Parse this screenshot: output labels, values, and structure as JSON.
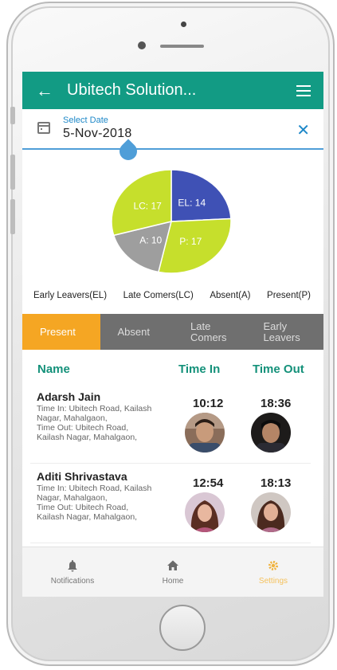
{
  "appbar": {
    "title": "Ubitech Solution..."
  },
  "date_picker": {
    "label": "Select Date",
    "value": "5-Nov-2018"
  },
  "pie": {
    "slices": [
      {
        "label": "EL: 14",
        "value": 14,
        "color": "#3f51b5"
      },
      {
        "label": "P: 17",
        "value": 17,
        "color": "#c6df2c"
      },
      {
        "label": "A: 10",
        "value": 10,
        "color": "#9e9e9e"
      },
      {
        "label": "LC: 17",
        "value": 17,
        "color": "#c6df2c"
      }
    ]
  },
  "legend": {
    "el": "Early Leavers(EL)",
    "lc": "Late Comers(LC)",
    "a": "Absent(A)",
    "p": "Present(P)"
  },
  "tabs": {
    "present": "Present",
    "absent": "Absent",
    "late_1": "Late",
    "late_2": "Comers",
    "early_1": "Early",
    "early_2": "Leavers"
  },
  "list_header": {
    "name": "Name",
    "time_in": "Time In",
    "time_out": "Time Out"
  },
  "rows": [
    {
      "name": "Adarsh Jain",
      "detail_1": "Time In: Ubitech Road, Kailash",
      "detail_2": "Nagar, Mahalgaon,",
      "detail_3": "Time Out: Ubitech Road,",
      "detail_4": "Kailash Nagar, Mahalgaon,",
      "time_in": "10:12",
      "time_out": "18:36"
    },
    {
      "name": "Aditi Shrivastava",
      "detail_1": "Time In: Ubitech Road, Kailash",
      "detail_2": "Nagar, Mahalgaon,",
      "detail_3": "Time Out: Ubitech Road,",
      "detail_4": "Kailash Nagar, Mahalgaon,",
      "time_in": "12:54",
      "time_out": "18:13"
    }
  ],
  "bottom_nav": {
    "notifications": "Notifications",
    "home": "Home",
    "settings": "Settings"
  },
  "colors": {
    "primary": "#129b84",
    "accent": "#f5a623",
    "link": "#1e88c8"
  }
}
